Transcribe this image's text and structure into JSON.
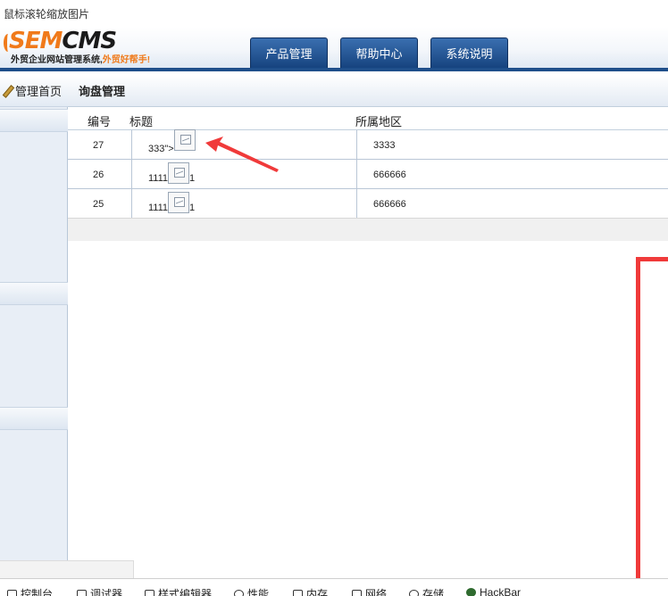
{
  "window": {
    "title": "鼠标滚轮缩放图片"
  },
  "logo": {
    "main_left": "SEM",
    "main_right": "CMS",
    "tagline": "外贸企业网站管理系统,",
    "tagline_highlight": "外贸好帮手!"
  },
  "nav": {
    "tabs": [
      {
        "label": "产品管理"
      },
      {
        "label": "帮助中心"
      },
      {
        "label": "系统说明"
      }
    ]
  },
  "sidebar": {
    "home": "管理首页"
  },
  "main": {
    "title": "询盘管理",
    "columns": {
      "id": "编号",
      "title": "标题",
      "region": "所属地区"
    },
    "rows": [
      {
        "id": "27",
        "title_prefix": "333\">",
        "title_suffix": "",
        "region": "3333"
      },
      {
        "id": "26",
        "title_prefix": "1111",
        "title_suffix": "1",
        "region": "666666"
      },
      {
        "id": "25",
        "title_prefix": "1111",
        "title_suffix": "1",
        "region": "666666"
      }
    ]
  },
  "devtools": {
    "items": [
      {
        "label": "控制台",
        "icon": "console-icon"
      },
      {
        "label": "调试器",
        "icon": "debugger-icon"
      },
      {
        "label": "样式编辑器",
        "icon": "style-editor-icon"
      },
      {
        "label": "性能",
        "icon": "performance-icon"
      },
      {
        "label": "内存",
        "icon": "memory-icon"
      },
      {
        "label": "网络",
        "icon": "network-icon"
      },
      {
        "label": "存储",
        "icon": "storage-icon"
      },
      {
        "label": "HackBar",
        "icon": "hackbar-icon"
      }
    ]
  },
  "colors": {
    "nav_tab": "#1e4e8a",
    "accent_orange": "#f07a1a",
    "annotation_red": "#f03a3a"
  }
}
